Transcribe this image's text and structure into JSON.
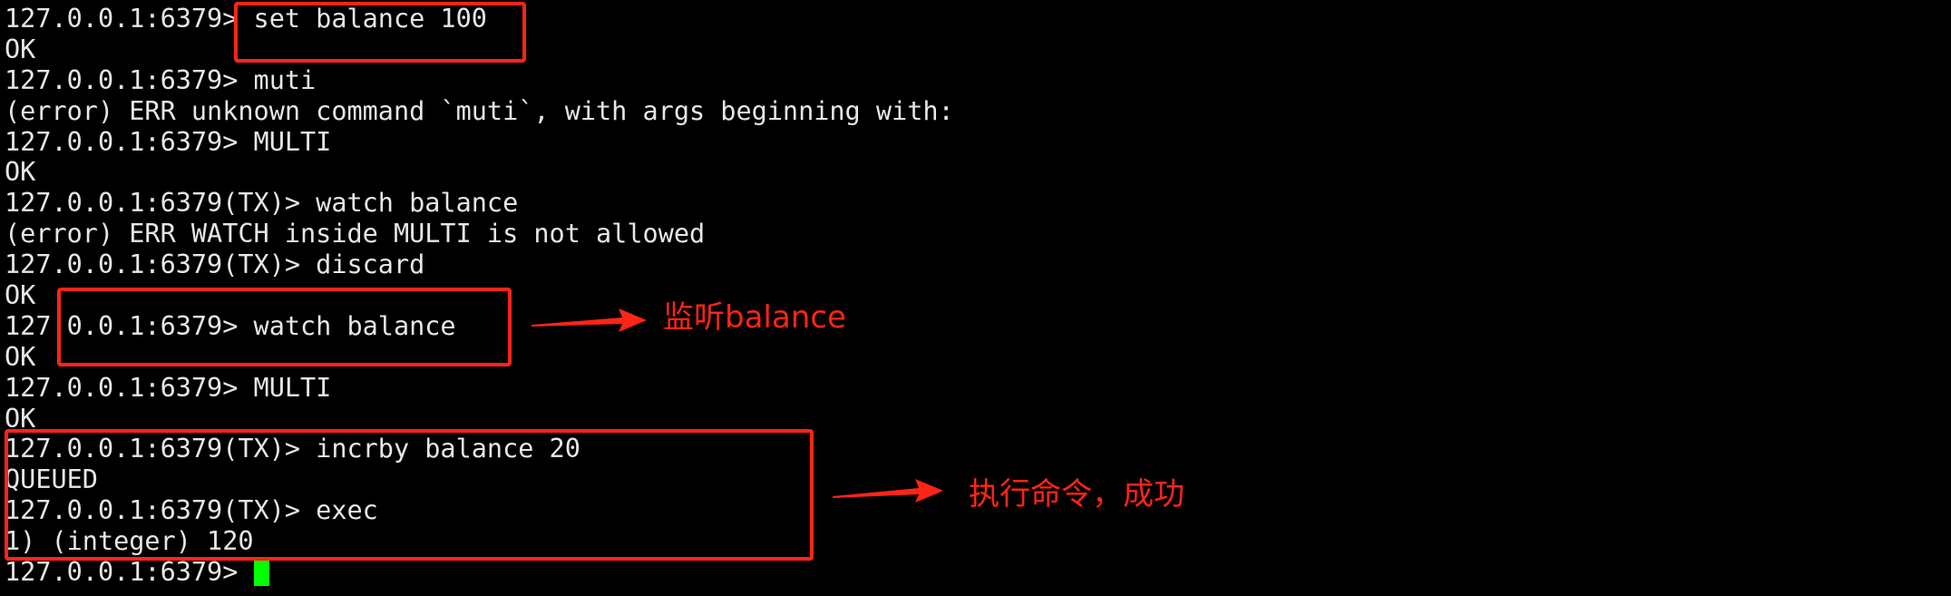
{
  "terminal": {
    "lines": [
      "127.0.0.1:6379> set balance 100",
      "OK",
      "127.0.0.1:6379> muti",
      "(error) ERR unknown command `muti`, with args beginning with:",
      "127.0.0.1:6379> MULTI",
      "OK",
      "127.0.0.1:6379(TX)> watch balance",
      "(error) ERR WATCH inside MULTI is not allowed",
      "127.0.0.1:6379(TX)> discard",
      "OK",
      "127.0.0.1:6379> watch balance",
      "OK",
      "127.0.0.1:6379> MULTI",
      "OK",
      "127.0.0.1:6379(TX)> incrby balance 20",
      "QUEUED",
      "127.0.0.1:6379(TX)> exec",
      "1) (integer) 120",
      "127.0.0.1:6379> "
    ]
  },
  "annotations": {
    "watch_note": "监听balance",
    "exec_note": "执行命令，成功"
  },
  "colors": {
    "background": "#000000",
    "text": "#e6e6e6",
    "annotation": "#ff2418",
    "cursor": "#00ff00"
  }
}
